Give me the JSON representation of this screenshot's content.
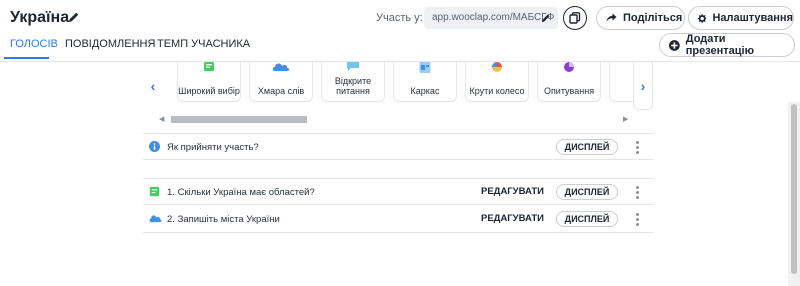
{
  "header": {
    "title": "Україна",
    "participate_label": "Участь у:",
    "join_url": "app.wooclap.com/МАБСГФ",
    "share_label": "Поділіться",
    "settings_label": "Налаштування",
    "add_presentation_label": "Додати презентацію"
  },
  "tabs": [
    {
      "label": "ГОЛОСІВ",
      "active": true
    },
    {
      "label": "ПОВІДОМЛЕННЯ",
      "active": false
    },
    {
      "label": "ТЕМП УЧАСНИКА",
      "active": false
    }
  ],
  "question_types": [
    {
      "label": "Широкий вибір",
      "icon": "multiple-choice-icon",
      "color": "#3fcf5a"
    },
    {
      "label": "Хмара слів",
      "icon": "word-cloud-icon",
      "color": "#3d8fe8"
    },
    {
      "label": "Відкрите питання",
      "icon": "open-question-icon",
      "color": "#6ec6f0"
    },
    {
      "label": "Каркас",
      "icon": "frame-icon",
      "color": "#3d8fe8"
    },
    {
      "label": "Крути колесо",
      "icon": "wheel-icon",
      "color": "#e8543d"
    },
    {
      "label": "Опитування",
      "icon": "poll-icon",
      "color": "#8a3fd8"
    }
  ],
  "how_to_join": {
    "text": "Як прийняти участь?",
    "display_label": "ДИСПЛЕЙ"
  },
  "questions": [
    {
      "number": "1.",
      "text": "Скільки Україна має областей?",
      "icon": "multiple-choice-icon",
      "color": "#3fcf5a",
      "edit_label": "РЕДАГУВАТИ",
      "display_label": "ДИСПЛЕЙ"
    },
    {
      "number": "2.",
      "text": "Запишіть міста України",
      "icon": "word-cloud-icon",
      "color": "#3d8fe8",
      "edit_label": "РЕДАГУВАТИ",
      "display_label": "ДИСПЛЕЙ"
    }
  ],
  "colors": {
    "accent": "#2b7de9",
    "text": "#1e2433"
  }
}
